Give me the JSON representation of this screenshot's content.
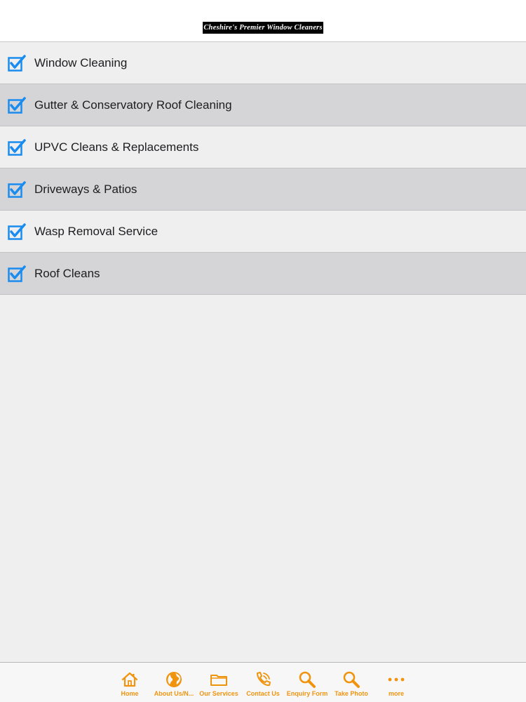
{
  "header": {
    "logo_text": "Cheshire's Premier Window Cleaners"
  },
  "colors": {
    "checkbox": "#1a8cf0",
    "tab_accent": "#f0940e",
    "row_light": "#efeff0",
    "row_dark": "#d5d5d7"
  },
  "services": [
    {
      "label": "Window Cleaning",
      "checked": true
    },
    {
      "label": "Gutter & Conservatory Roof Cleaning",
      "checked": true
    },
    {
      "label": "UPVC Cleans & Replacements",
      "checked": true
    },
    {
      "label": "Driveways & Patios",
      "checked": true
    },
    {
      "label": "Wasp Removal Service",
      "checked": true
    },
    {
      "label": "Roof Cleans",
      "checked": true
    }
  ],
  "tabs": [
    {
      "label": "Home",
      "icon": "home-icon"
    },
    {
      "label": "About Us/N...",
      "icon": "globe-icon"
    },
    {
      "label": "Our Services",
      "icon": "folder-icon"
    },
    {
      "label": "Contact Us",
      "icon": "phone-icon"
    },
    {
      "label": "Enquiry Form",
      "icon": "search-icon"
    },
    {
      "label": "Take Photo",
      "icon": "search-icon"
    },
    {
      "label": "more",
      "icon": "more-icon"
    }
  ]
}
